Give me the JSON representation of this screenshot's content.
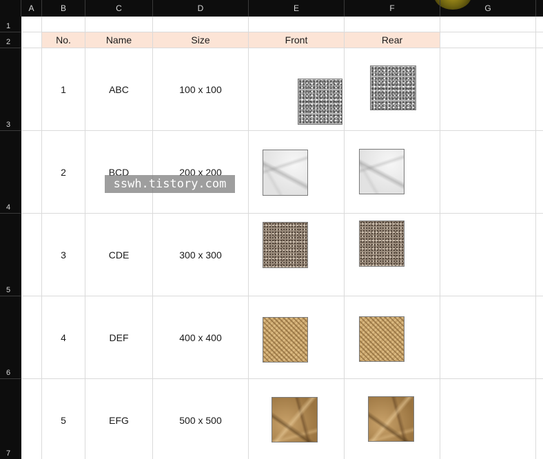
{
  "column_headers": [
    "A",
    "B",
    "C",
    "D",
    "E",
    "F",
    "G"
  ],
  "row_headers": [
    "1",
    "2",
    "3",
    "4",
    "5",
    "6",
    "7"
  ],
  "table": {
    "headers": [
      "No.",
      "Name",
      "Size",
      "Front",
      "Rear"
    ],
    "rows": [
      {
        "no": "1",
        "name": "ABC",
        "size": "100 x 100",
        "front_texture": "granite-texture",
        "rear_texture": "granite-texture"
      },
      {
        "no": "2",
        "name": "BCD",
        "size": "200 x 200",
        "front_texture": "marble-texture",
        "rear_texture": "marble-texture"
      },
      {
        "no": "3",
        "name": "CDE",
        "size": "300 x 300",
        "front_texture": "gravel-texture",
        "rear_texture": "gravel-texture"
      },
      {
        "no": "4",
        "name": "DEF",
        "size": "400 x 400",
        "front_texture": "burlap-texture",
        "rear_texture": "burlap-texture"
      },
      {
        "no": "5",
        "name": "EFG",
        "size": "500 x 500",
        "front_texture": "crumpled-paper-texture",
        "rear_texture": "crumpled-paper-texture"
      }
    ]
  },
  "watermark": "sswh.tistory.com",
  "colors": {
    "header_band": "#fce4d6",
    "grid": "#dadada",
    "chrome": "#0d0d0d"
  }
}
